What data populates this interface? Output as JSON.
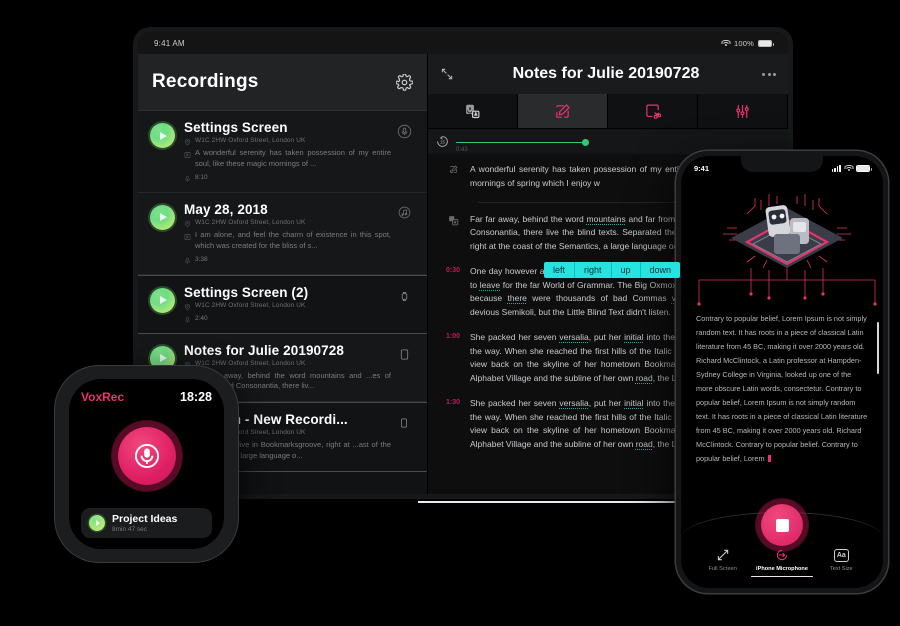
{
  "tablet": {
    "status": {
      "time": "9:41 AM",
      "battery_percent": "100%",
      "wifi_icon": "wifi-icon"
    },
    "sidebar": {
      "title": "Recordings",
      "settings_icon": "gear-icon",
      "recordings": [
        {
          "title": "Settings Screen",
          "location": "W1C 2HW Oxford Street, London UK",
          "snippet": "A wonderful serenity has taken possession of my entire soul, like these magic mornings of ...",
          "duration": "8:10",
          "device_icon": "microphone-circle-icon",
          "selected": false
        },
        {
          "title": "May 28, 2018",
          "location": "W1C 2HW Oxford Street, London UK",
          "snippet": "I am alone, and feel the charm of existence in this spot, which was created for the bliss of s...",
          "duration": "3:38",
          "device_icon": "music-note-icon",
          "selected": false
        },
        {
          "title": "Settings Screen (2)",
          "location": "W1C 2HW Oxford Street, London UK",
          "snippet": "",
          "duration": "2:40",
          "device_icon": "watch-icon",
          "selected": true
        },
        {
          "title": "Notes for Julie 20190728",
          "location": "W1C 2HW Oxford Street, London UK",
          "snippet": "Far far away, behind the word mountains and ...es of Vokalia and Consonantia, there liv...",
          "duration": "",
          "device_icon": "tablet-icon",
          "selected": false
        },
        {
          "title": "Revision - New Recordi...",
          "location": "W1C 2HW Oxford Street, London UK",
          "snippet": "...rated they live in Bookmarksgroove, right at ...ast of the Semantics, a large language o...",
          "duration": "",
          "device_icon": "phone-icon",
          "selected": false
        }
      ]
    },
    "detail": {
      "expand_icon": "expand-diagonal-icon",
      "title": "Notes for Julie 20190728",
      "more_icon": "more-options-icon",
      "tabs": [
        {
          "name": "tab-transcribe",
          "icon": "microphone-text-icon",
          "active": false
        },
        {
          "name": "tab-edit",
          "icon": "edit-pencil-icon",
          "active": true
        },
        {
          "name": "tab-cut",
          "icon": "cut-scissors-icon",
          "active": false
        },
        {
          "name": "tab-settings",
          "icon": "sliders-icon",
          "active": false
        }
      ],
      "player": {
        "rewind_icon": "rewind-15-icon",
        "current_time": "0:43",
        "progress_percent": 39
      },
      "suggestions": [
        "left",
        "right",
        "up",
        "down"
      ],
      "lines": [
        {
          "marker": "edit-pencil-icon",
          "marker_type": "icon",
          "text": "A wonderful serenity has taken possession of my entire soul, like these sweet mornings of spring which I enjoy w"
        },
        {
          "marker": "copy-text-icon",
          "marker_type": "icon",
          "text": "Far far away, behind the word mountains and far from the countries Vokalia and Consonantia, there live the blind texts. Separated they live in Bookmarksgrove right at the coast of the Semantics, a large language ocean."
        },
        {
          "marker": "0:30",
          "marker_type": "time",
          "text": "One day however a small line of blind text by the name of Lorem Ipsum decided to leave for the far World of Grammar. The Big Oxmox advised her not to do so, because there were thousands of bad Commas wild Question Marks and devious Semikoli, but the Little Blind Text didn't listen."
        },
        {
          "marker": "1:00",
          "marker_type": "time",
          "text": "She packed her seven versalia, put her initial into the belt and made herself on the way. When she reached the first hills of the Italic Mountains, she had a last view back on the skyline of her hometown Bookmarksgrove, the headline of Alphabet Village and the subline of her own road, the Line Fast Lane."
        },
        {
          "marker": "1:30",
          "marker_type": "time",
          "text": "She packed her seven versalia, put her initial into the belt and made herself on the way. When she reached the first hills of the Italic Mountains, she had a last view back on the skyline of her hometown Bookmarksgrove, the headline of Alphabet Village and the subline of her own road, the Line Fast Lane."
        }
      ]
    }
  },
  "watch": {
    "brand": "VoxRec",
    "time": "18:28",
    "record_icon": "microphone-record-icon",
    "card": {
      "title": "Project Ideas",
      "subtitle": "8min 47 sec",
      "play_icon": "play-icon"
    }
  },
  "phone": {
    "status": {
      "time": "9:41",
      "signal_icon": "signal-bars-icon",
      "wifi_icon": "wifi-icon",
      "battery_icon": "battery-icon"
    },
    "hero_icon": "ai-robot-chip-illustration",
    "body": "Contrary to popular belief, Lorem Ipsum is not simply random text. It has roots in a piece of classical Latin literature from 45 BC, making it over 2000 years old. Richard McClintock, a Latin professor at Hampden-Sydney College in Virginia, looked up one of the more obscure Latin words, consectetur. Contrary to popular belief, Lorem Ipsum is not simply random text. It has roots in a piece of classical Latin literature from 45 BC, making it over 2000 years old. Richard McClintock. Contrary to popular belief. Contrary to popular belief, Lorem ",
    "record_button": "stop-record-button",
    "actions": [
      {
        "label": "Full Screen",
        "icon": "fullscreen-arrows-icon",
        "active": false
      },
      {
        "label": "iPhone Microphone",
        "icon": "microphone-input-icon",
        "active": true
      },
      {
        "label": "Text Size",
        "icon": "text-size-icon",
        "active": false
      }
    ]
  },
  "colors": {
    "accent_pink": "#e8336b",
    "accent_green": "#2ecc71",
    "suggest_cyan": "#24e3e0",
    "timestamp": "#c2185b"
  }
}
